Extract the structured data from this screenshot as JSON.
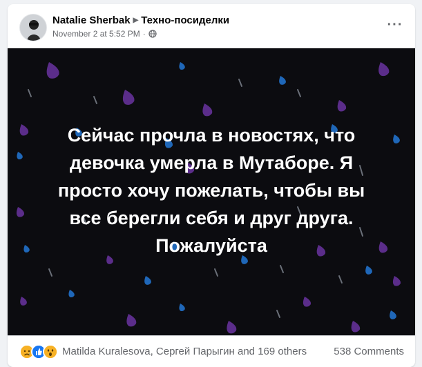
{
  "post": {
    "author": "Natalie Sherbak",
    "group": "Техно-посиделки",
    "timestamp": "November 2 at 5:52 PM",
    "privacy_icon": "globe-icon",
    "more_icon": "more-horizontal-icon",
    "more_label": "···"
  },
  "media": {
    "background": "#0c0c10",
    "lines": [
      "Сейчас прочла в новостях, что",
      "девочка умерла в Мутаборе. Я",
      "просто хочу пожелать, чтобы вы",
      "все берегли себя и друг друга.",
      "Пожалуйста"
    ],
    "drop_colors": [
      "#5b2d8a",
      "#1f67b8",
      "#6a6f78"
    ]
  },
  "reactions": {
    "icons": [
      "sad-reaction-icon",
      "like-reaction-icon",
      "wow-reaction-icon"
    ],
    "names": "Matilda Kuralesova, Сергей Парыгин and 169 others",
    "comments": "538 Comments"
  }
}
